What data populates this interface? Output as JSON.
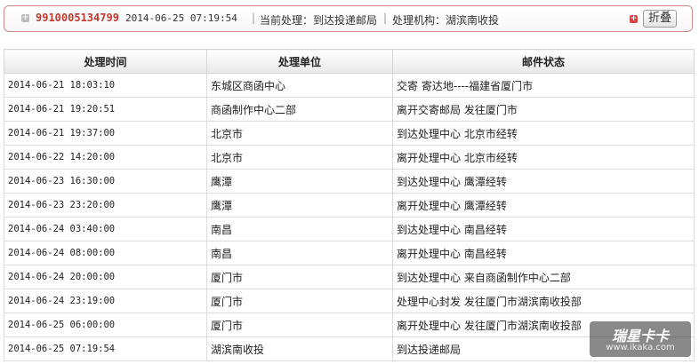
{
  "summary": {
    "expand_glyph": "+",
    "waybill": "9910005134799",
    "time": "2014-06-25 07:19:54",
    "separator": "|",
    "current_status": "当前处理：到达投递邮局",
    "current_office": "处理机构：湖滨南收投",
    "close_glyph": "+",
    "collapse_label": "折叠"
  },
  "table": {
    "headers": [
      "处理时间",
      "处理单位",
      "邮件状态"
    ],
    "rows": [
      {
        "time": "2014-06-21 18:03:10",
        "unit": "东城区商函中心",
        "status": "交寄 寄达地----福建省厦门市"
      },
      {
        "time": "2014-06-21 19:20:51",
        "unit": "商函制作中心二部",
        "status": "离开交寄邮局 发往厦门市"
      },
      {
        "time": "2014-06-21 19:37:00",
        "unit": "北京市",
        "status": "到达处理中心 北京市经转"
      },
      {
        "time": "2014-06-22 14:20:00",
        "unit": "北京市",
        "status": "离开处理中心 北京市经转"
      },
      {
        "time": "2014-06-23 16:30:00",
        "unit": "鹰潭",
        "status": "到达处理中心 鹰潭经转"
      },
      {
        "time": "2014-06-23 23:20:00",
        "unit": "鹰潭",
        "status": "离开处理中心 鹰潭经转"
      },
      {
        "time": "2014-06-24 03:40:00",
        "unit": "南昌",
        "status": "到达处理中心 南昌经转"
      },
      {
        "time": "2014-06-24 08:00:00",
        "unit": "南昌",
        "status": "离开处理中心 南昌经转"
      },
      {
        "time": "2014-06-24 20:00:00",
        "unit": "厦门市",
        "status": "到达处理中心 来自商函制作中心二部"
      },
      {
        "time": "2014-06-24 23:19:00",
        "unit": "厦门市",
        "status": "处理中心封发 发往厦门市湖滨南收投部"
      },
      {
        "time": "2014-06-25 06:00:00",
        "unit": "厦门市",
        "status": "离开处理中心 发往厦门市湖滨南收投部"
      },
      {
        "time": "2014-06-25 07:19:54",
        "unit": "湖滨南收投",
        "status": "到达投递邮局"
      }
    ]
  },
  "watermark": {
    "title": "瑞星卡卡",
    "url": "www.ikaka.com"
  },
  "colors": {
    "waybill": "#c0392b",
    "summary_border": "#d98a8a",
    "close_icon": "#d64545"
  }
}
